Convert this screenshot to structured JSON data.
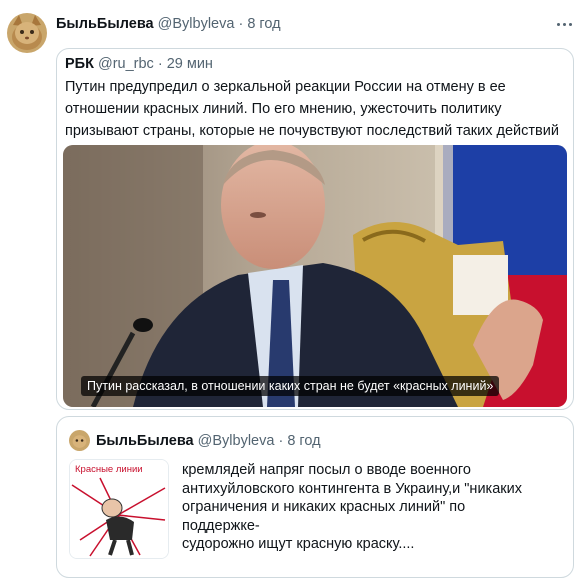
{
  "tweet": {
    "author_name": "БыльБылева",
    "author_handle": "@Bylbyleva",
    "separator": " · ",
    "time": "8 год",
    "more_icon": "more-horizontal-icon"
  },
  "quoted_tweet": {
    "author_name": "РБК",
    "author_handle": "@ru_rbc",
    "separator": " · ",
    "time": "29 мин",
    "text": "Путин предупредил о зеркальной реакции России на отмену в ее отношении красных линий. По его мнению, ужесточить политику призывают страны, которые не почувствуют последствий таких действий",
    "media_caption": "Путин рассказал, в отношении каких стран не будет «красных линий»"
  },
  "nested_quote": {
    "author_name": "БыльБылева",
    "author_handle": "@Bylbyleva",
    "separator": " · ",
    "time": "8 год",
    "thumbnail_label": "Красные линии",
    "text_lines": [
      "кремлядей напряг посыл о вводе военного",
      "антихуйловского контингента в Украину,и \"никаких",
      "ограничения и никаких красных линий\" по",
      "поддержке-",
      "судорожно ищут красную краску...."
    ]
  },
  "colors": {
    "text": "#0f1419",
    "secondary": "#536471",
    "border": "#cfd9de",
    "flag_blue": "#1d3fa6",
    "flag_red": "#c8102e"
  }
}
